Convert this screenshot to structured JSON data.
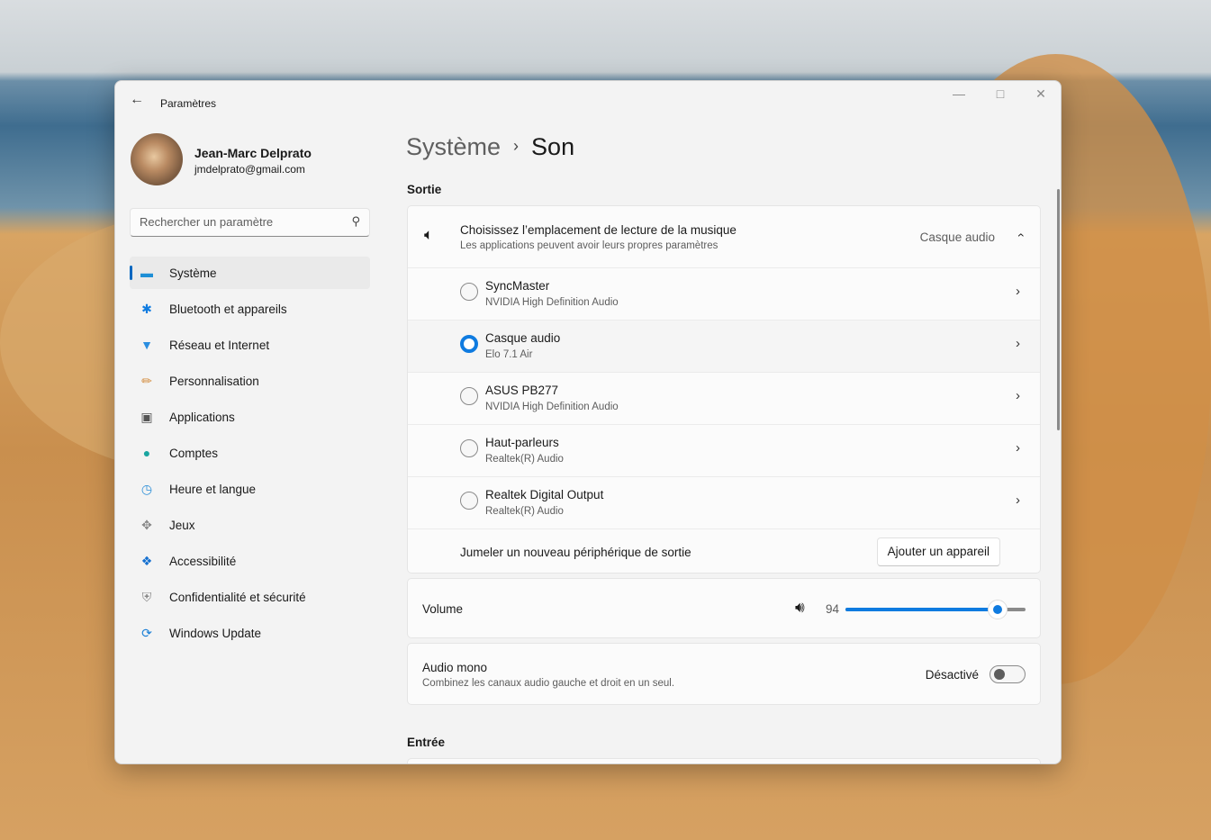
{
  "window": {
    "title": "Paramètres",
    "back_icon": "arrow-left-icon",
    "controls": [
      "minimize-icon",
      "maximize-icon",
      "close-icon"
    ]
  },
  "user": {
    "name": "Jean-Marc Delprato",
    "email": "jmdelprato@gmail.com"
  },
  "search": {
    "placeholder": "Rechercher un paramètre",
    "icon": "search-icon"
  },
  "sidebar": {
    "items": [
      {
        "label": "Système",
        "icon": "system-icon",
        "selected": true
      },
      {
        "label": "Bluetooth et appareils",
        "icon": "bluetooth-icon"
      },
      {
        "label": "Réseau et Internet",
        "icon": "wifi-icon"
      },
      {
        "label": "Personnalisation",
        "icon": "brush-icon"
      },
      {
        "label": "Applications",
        "icon": "apps-icon"
      },
      {
        "label": "Comptes",
        "icon": "account-icon"
      },
      {
        "label": "Heure et langue",
        "icon": "clock-globe-icon"
      },
      {
        "label": "Jeux",
        "icon": "gamepad-icon"
      },
      {
        "label": "Accessibilité",
        "icon": "accessibility-icon"
      },
      {
        "label": "Confidentialité et sécurité",
        "icon": "shield-icon"
      },
      {
        "label": "Windows Update",
        "icon": "update-icon"
      }
    ]
  },
  "breadcrumb": {
    "parent": "Système",
    "current": "Son"
  },
  "output": {
    "section": "Sortie",
    "header": {
      "title": "Choisissez l’emplacement de lecture de la musique",
      "subtitle": "Les applications peuvent avoir leurs propres paramètres",
      "value": "Casque audio"
    },
    "devices": [
      {
        "name": "SyncMaster",
        "driver": "NVIDIA High Definition Audio",
        "selected": false
      },
      {
        "name": "Casque audio",
        "driver": "Elo 7.1 Air",
        "selected": true
      },
      {
        "name": "ASUS PB277",
        "driver": "NVIDIA High Definition Audio",
        "selected": false
      },
      {
        "name": "Haut-parleurs",
        "driver": "Realtek(R) Audio",
        "selected": false
      },
      {
        "name": "Realtek Digital Output",
        "driver": "Realtek(R) Audio",
        "selected": false
      }
    ],
    "pair_label": "Jumeler un nouveau périphérique de sortie",
    "add_button": "Ajouter un appareil"
  },
  "volume": {
    "label": "Volume",
    "value": "94",
    "level": 94,
    "accent": "#0f7be0"
  },
  "mono": {
    "title": "Audio mono",
    "subtitle": "Combinez les canaux audio gauche et droit en un seul.",
    "state": "Désactivé",
    "on": false
  },
  "input": {
    "section": "Entrée"
  }
}
